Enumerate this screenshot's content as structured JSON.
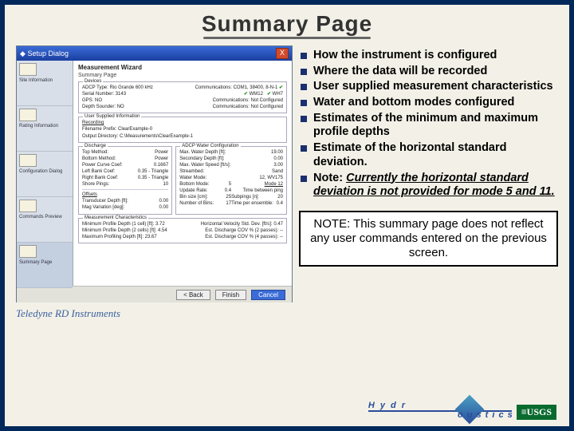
{
  "title": "Summary Page",
  "screenshot": {
    "window_title": "Setup Dialog",
    "close": "X",
    "wizard_title": "Measurement Wizard",
    "wizard_sub": "Summary Page",
    "sidebar": {
      "items": [
        {
          "label": "Site Information"
        },
        {
          "label": "Rating Information"
        },
        {
          "label": "Configuration Dialog"
        },
        {
          "label": "Commands Preview"
        },
        {
          "label": "Summary Page"
        }
      ]
    },
    "devices": {
      "legend": "Devices",
      "adcp_type_l": "ADCP Type:",
      "adcp_type_v": "Rio Grande 600 kHz",
      "comm_l": "Communications:",
      "comm_v": "COM1, 38400, 8-N-1",
      "serial_l": "Serial Number:",
      "serial_v": "3143",
      "wm12_l": "WM12",
      "wm12_yes": "✔",
      "wh7_l": "WH7",
      "wh7_yes": "✔",
      "gps_l": "GPS:",
      "gps_v": "NO",
      "gps_c": "Communications:  Not Configured",
      "dep_l": "Depth Sounder:",
      "dep_v": "NO",
      "dep_c": "Communications:  Not Configured"
    },
    "user": {
      "legend": "User Supplied Information",
      "rec": "Recording",
      "prefix_l": "Filename Prefix:",
      "prefix_v": "ClearExample-0",
      "outdir_l": "Output Directory:",
      "outdir_v": "C:\\Measurements\\ClearExample-1"
    },
    "discharge": {
      "legend": "Discharge",
      "top_l": "Top Method:",
      "top_v": "Power",
      "bot_l": "Bottom Method:",
      "bot_v": "Power",
      "pcc_l": "Power Curve Coef:",
      "pcc_v": "0.1667",
      "lbc_l": "Left Bank Coef:",
      "lbc_v": "0.35 - Triangle",
      "rbc_l": "Right Bank Coef:",
      "rbc_v": "0.35 - Triangle",
      "shp_l": "Shore Pings:",
      "shp_v": "10"
    },
    "adcp": {
      "legend": "ADCP Water Configuration",
      "max_l": "Max. Water Depth [ft]:",
      "max_v": "19.00",
      "sec_l": "Secondary Depth [ft]:",
      "sec_v": "0.00",
      "spd_l": "Max. Water Speed [ft/s]:",
      "spd_v": "3.00",
      "str_l": "Streambed:",
      "str_v": "Sand",
      "mode_l": "Water Mode:",
      "mode_v": "12, WV175",
      "mode12": "Mode 12",
      "bmode_l": "Bottom Mode:",
      "bmode_v": "5",
      "upd_l": "Update Rate:",
      "upd_v": "0.4",
      "tbe_l": "Time between ping",
      "sub_l": "Subpings [n]:",
      "sub_v": "20",
      "bin_l": "Bin size [cm]:",
      "bin_v": "25",
      "nbin_l": "Number of Bins:",
      "nbin_v": "17",
      "tpe_l": "Time per ensemble:",
      "tpe_v": "0.4"
    },
    "offsets": {
      "legend": "Offsets",
      "td_l": "Transducer Depth [ft]:",
      "td_v": "0.00",
      "mv_l": "Mag Variation [deg]:",
      "mv_v": "0.00"
    },
    "meas": {
      "legend": "Measurement Characteristics",
      "min_l": "Minimum Profile Depth (1 cell) [ft]:",
      "min_v": "3.72",
      "minb_l": "Minimum Profile Depth (2 cells) [ft]:",
      "minb_v": "4.54",
      "maxp_l": "Maximum Profiling Depth [ft]:",
      "maxp_v": "23.67",
      "hv_l": "Horizontal Velocity Std. Dev. [ft/s]:",
      "hv_v": "0.47",
      "dcv_l": "Est. Discharge COV % (2 passes):",
      "dcv_v": "--",
      "dcv4_l": "Est. Discharge COV % (4 passes):",
      "dcv4_v": "--"
    },
    "footer": {
      "back": "< Back",
      "finish": "Finish",
      "cancel": "Cancel"
    },
    "branding": "Teledyne RD Instruments"
  },
  "bullets": [
    "How the instrument is configured",
    "Where the data will be recorded",
    "User supplied measurement characteristics",
    "Water and bottom modes configured",
    "Estimates of the minimum and maximum profile depths",
    "Estimate of the horizontal standard deviation."
  ],
  "bullet_note_prefix": "Note: ",
  "bullet_note_body": "Currently the horizontal standard deviation is not provided for mode 5 and 11.",
  "note_box": "NOTE: This summary page does not reflect any user commands entered on the previous screen.",
  "logo": {
    "hydro_l": "H y d r",
    "hydro_r": "o u s t i c s",
    "usgs": "≡USGS"
  }
}
